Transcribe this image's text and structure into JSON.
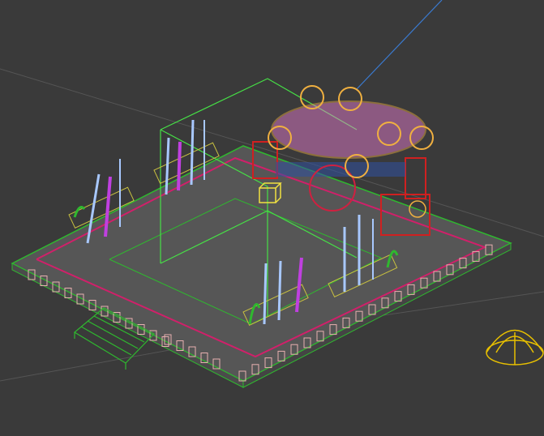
{
  "viewport": {
    "background": "#3a3a3a",
    "colors": {
      "platform_edge": "#2fb82f",
      "grid_line": "#5a5a5a",
      "path_line": "#d0206a",
      "posts": "#e8b0b0",
      "weapons_blue": "#a8c8ff",
      "weapons_purple": "#c040e0",
      "gate_red": "#d02020",
      "gate_gold": "#f0b040",
      "gate_pink": "#f080d8",
      "selection_box": "#46e046",
      "gizmo_yellow": "#f0e040",
      "light_line": "#3a7ad0",
      "light_gizmo": "#e8c000"
    },
    "icons": [
      "light-gizmo-icon",
      "selection-cube-icon"
    ]
  }
}
